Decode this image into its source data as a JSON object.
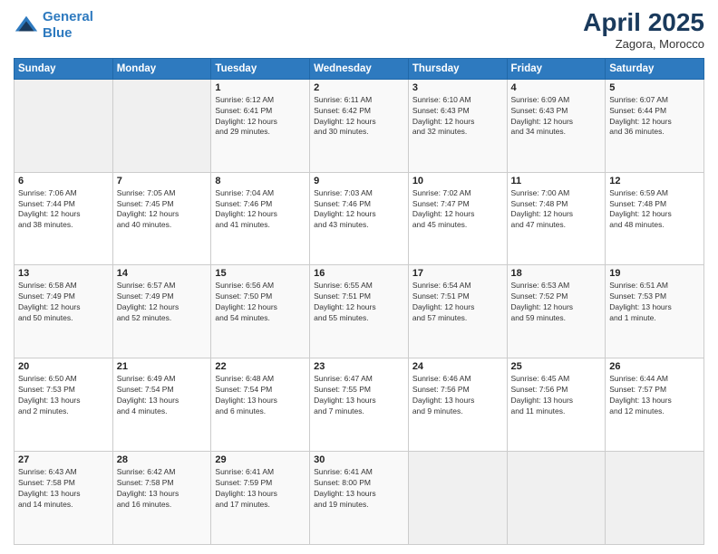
{
  "logo": {
    "line1": "General",
    "line2": "Blue"
  },
  "title": "April 2025",
  "location": "Zagora, Morocco",
  "days_header": [
    "Sunday",
    "Monday",
    "Tuesday",
    "Wednesday",
    "Thursday",
    "Friday",
    "Saturday"
  ],
  "weeks": [
    [
      {
        "day": "",
        "info": ""
      },
      {
        "day": "",
        "info": ""
      },
      {
        "day": "1",
        "info": "Sunrise: 6:12 AM\nSunset: 6:41 PM\nDaylight: 12 hours\nand 29 minutes."
      },
      {
        "day": "2",
        "info": "Sunrise: 6:11 AM\nSunset: 6:42 PM\nDaylight: 12 hours\nand 30 minutes."
      },
      {
        "day": "3",
        "info": "Sunrise: 6:10 AM\nSunset: 6:43 PM\nDaylight: 12 hours\nand 32 minutes."
      },
      {
        "day": "4",
        "info": "Sunrise: 6:09 AM\nSunset: 6:43 PM\nDaylight: 12 hours\nand 34 minutes."
      },
      {
        "day": "5",
        "info": "Sunrise: 6:07 AM\nSunset: 6:44 PM\nDaylight: 12 hours\nand 36 minutes."
      }
    ],
    [
      {
        "day": "6",
        "info": "Sunrise: 7:06 AM\nSunset: 7:44 PM\nDaylight: 12 hours\nand 38 minutes."
      },
      {
        "day": "7",
        "info": "Sunrise: 7:05 AM\nSunset: 7:45 PM\nDaylight: 12 hours\nand 40 minutes."
      },
      {
        "day": "8",
        "info": "Sunrise: 7:04 AM\nSunset: 7:46 PM\nDaylight: 12 hours\nand 41 minutes."
      },
      {
        "day": "9",
        "info": "Sunrise: 7:03 AM\nSunset: 7:46 PM\nDaylight: 12 hours\nand 43 minutes."
      },
      {
        "day": "10",
        "info": "Sunrise: 7:02 AM\nSunset: 7:47 PM\nDaylight: 12 hours\nand 45 minutes."
      },
      {
        "day": "11",
        "info": "Sunrise: 7:00 AM\nSunset: 7:48 PM\nDaylight: 12 hours\nand 47 minutes."
      },
      {
        "day": "12",
        "info": "Sunrise: 6:59 AM\nSunset: 7:48 PM\nDaylight: 12 hours\nand 48 minutes."
      }
    ],
    [
      {
        "day": "13",
        "info": "Sunrise: 6:58 AM\nSunset: 7:49 PM\nDaylight: 12 hours\nand 50 minutes."
      },
      {
        "day": "14",
        "info": "Sunrise: 6:57 AM\nSunset: 7:49 PM\nDaylight: 12 hours\nand 52 minutes."
      },
      {
        "day": "15",
        "info": "Sunrise: 6:56 AM\nSunset: 7:50 PM\nDaylight: 12 hours\nand 54 minutes."
      },
      {
        "day": "16",
        "info": "Sunrise: 6:55 AM\nSunset: 7:51 PM\nDaylight: 12 hours\nand 55 minutes."
      },
      {
        "day": "17",
        "info": "Sunrise: 6:54 AM\nSunset: 7:51 PM\nDaylight: 12 hours\nand 57 minutes."
      },
      {
        "day": "18",
        "info": "Sunrise: 6:53 AM\nSunset: 7:52 PM\nDaylight: 12 hours\nand 59 minutes."
      },
      {
        "day": "19",
        "info": "Sunrise: 6:51 AM\nSunset: 7:53 PM\nDaylight: 13 hours\nand 1 minute."
      }
    ],
    [
      {
        "day": "20",
        "info": "Sunrise: 6:50 AM\nSunset: 7:53 PM\nDaylight: 13 hours\nand 2 minutes."
      },
      {
        "day": "21",
        "info": "Sunrise: 6:49 AM\nSunset: 7:54 PM\nDaylight: 13 hours\nand 4 minutes."
      },
      {
        "day": "22",
        "info": "Sunrise: 6:48 AM\nSunset: 7:54 PM\nDaylight: 13 hours\nand 6 minutes."
      },
      {
        "day": "23",
        "info": "Sunrise: 6:47 AM\nSunset: 7:55 PM\nDaylight: 13 hours\nand 7 minutes."
      },
      {
        "day": "24",
        "info": "Sunrise: 6:46 AM\nSunset: 7:56 PM\nDaylight: 13 hours\nand 9 minutes."
      },
      {
        "day": "25",
        "info": "Sunrise: 6:45 AM\nSunset: 7:56 PM\nDaylight: 13 hours\nand 11 minutes."
      },
      {
        "day": "26",
        "info": "Sunrise: 6:44 AM\nSunset: 7:57 PM\nDaylight: 13 hours\nand 12 minutes."
      }
    ],
    [
      {
        "day": "27",
        "info": "Sunrise: 6:43 AM\nSunset: 7:58 PM\nDaylight: 13 hours\nand 14 minutes."
      },
      {
        "day": "28",
        "info": "Sunrise: 6:42 AM\nSunset: 7:58 PM\nDaylight: 13 hours\nand 16 minutes."
      },
      {
        "day": "29",
        "info": "Sunrise: 6:41 AM\nSunset: 7:59 PM\nDaylight: 13 hours\nand 17 minutes."
      },
      {
        "day": "30",
        "info": "Sunrise: 6:41 AM\nSunset: 8:00 PM\nDaylight: 13 hours\nand 19 minutes."
      },
      {
        "day": "",
        "info": ""
      },
      {
        "day": "",
        "info": ""
      },
      {
        "day": "",
        "info": ""
      }
    ]
  ]
}
